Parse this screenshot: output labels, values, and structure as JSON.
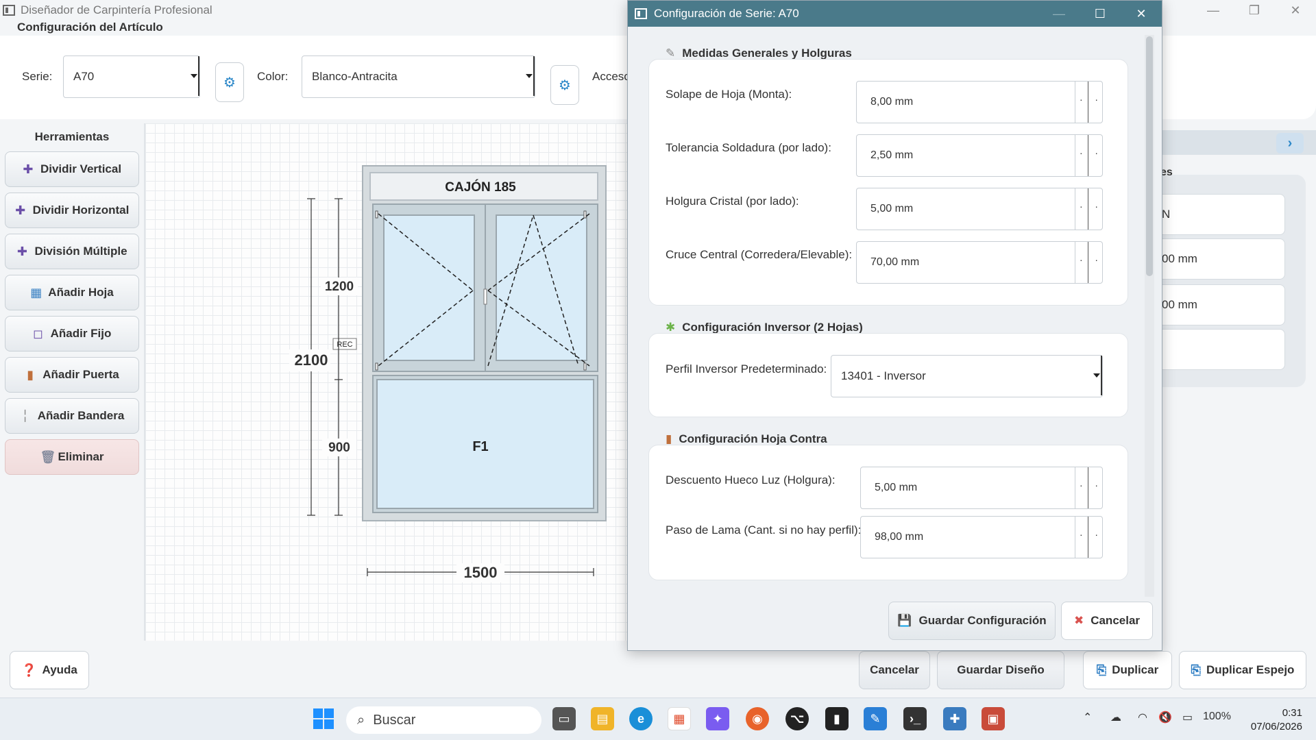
{
  "window": {
    "title": "Diseñador de Carpintería Profesional",
    "minimize": "—",
    "maximize": "❐",
    "close": "✕"
  },
  "article": {
    "section_title": "Configuración del Artículo",
    "serie_label": "Serie:",
    "serie_value": "A70",
    "color_label": "Color:",
    "color_value": "Blanco-Antracita",
    "accessories_label": "Acceso"
  },
  "tools": {
    "title": "Herramientas",
    "items": [
      {
        "label": "Dividir Vertical",
        "icon": "plus-icon"
      },
      {
        "label": "Dividir Horizontal",
        "icon": "plus-icon"
      },
      {
        "label": "División Múltiple",
        "icon": "plus-icon"
      },
      {
        "label": "Añadir Hoja",
        "icon": "sash-icon"
      },
      {
        "label": "Añadir Fijo",
        "icon": "fixed-icon"
      },
      {
        "label": "Añadir Puerta",
        "icon": "door-icon"
      },
      {
        "label": "Añadir Bandera",
        "icon": "flag-icon"
      },
      {
        "label": "Eliminar",
        "icon": "trash-icon"
      }
    ]
  },
  "drawing": {
    "box_label": "CAJÓN 185",
    "fixed_label": "F1",
    "rec_label": "REC",
    "total_height": "2100",
    "top_height": "1200",
    "bottom_height": "900",
    "total_width": "1500"
  },
  "right_panel": {
    "label_fragment": "es",
    "item1": "N",
    "item2": "00 mm",
    "item3": "00 mm"
  },
  "bottom": {
    "help": "Ayuda",
    "cancel": "Cancelar",
    "save_design": "Guardar Diseño",
    "duplicate": "Duplicar",
    "duplicate_mirror": "Duplicar Espejo"
  },
  "dialog": {
    "title": "Configuración de Serie: A70",
    "group1": {
      "title": "Medidas Generales y Holguras",
      "rows": [
        {
          "label": "Solape de Hoja (Monta):",
          "value": "8,00 mm"
        },
        {
          "label": "Tolerancia Soldadura (por lado):",
          "value": "2,50 mm"
        },
        {
          "label": "Holgura Cristal (por lado):",
          "value": "5,00 mm"
        },
        {
          "label": "Cruce Central (Corredera/Elevable):",
          "value": "70,00 mm"
        }
      ]
    },
    "group2": {
      "title": "Configuración Inversor (2 Hojas)",
      "label": "Perfil Inversor Predeterminado:",
      "value": "13401 - Inversor"
    },
    "group3": {
      "title": "Configuración Hoja Contra",
      "rows": [
        {
          "label": "Descuento Hueco Luz (Holgura):",
          "value": "5,00 mm"
        },
        {
          "label": "Paso de Lama (Cant. si no hay perfil):",
          "value": "98,00 mm"
        }
      ]
    },
    "save_button": "Guardar Configuración",
    "cancel_button": "Cancelar"
  },
  "taskbar": {
    "search_placeholder": "Buscar",
    "battery": "100%",
    "time": "0:31",
    "date": "07/06/2026"
  },
  "colors": {
    "dialog_titlebar": "#4a7a8a",
    "accent": "#2b87c8",
    "danger": "#d9534f"
  }
}
